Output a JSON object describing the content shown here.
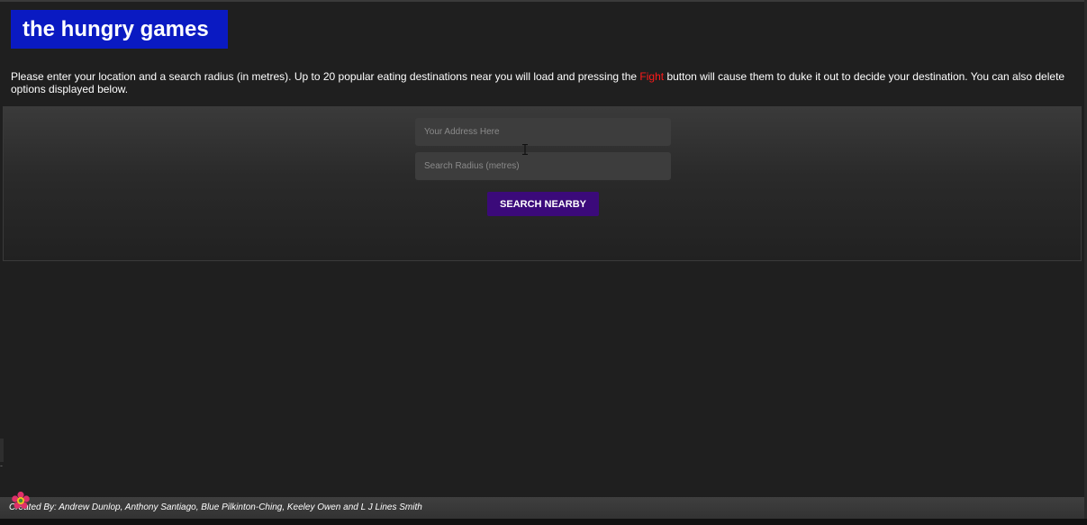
{
  "header": {
    "title": "the hungry games"
  },
  "intro": {
    "text_before": "Please enter your location and a search radius (in metres). Up to 20 popular eating destinations near you will load and pressing the ",
    "highlight": "Fight",
    "text_after": " button will cause them to duke it out to decide your destination. You can also delete options displayed below."
  },
  "search": {
    "address_placeholder": "Your Address Here",
    "address_value": "",
    "radius_placeholder": "Search Radius (metres)",
    "radius_value": "",
    "button_label": "SEARCH NEARBY"
  },
  "footer": {
    "credits": "Created By: Andrew Dunlop, Anthony Santiago, Blue Pilkinton-Ching, Keeley Owen and L J Lines Smith"
  },
  "colors": {
    "title_background": "#0a1ac2",
    "highlight": "#ff1a1a",
    "button_background": "#3b0a7a",
    "page_background": "#1f1f1f"
  },
  "icons": {
    "text_cursor": "i-beam-cursor-icon",
    "overlay": "flower-icon"
  }
}
